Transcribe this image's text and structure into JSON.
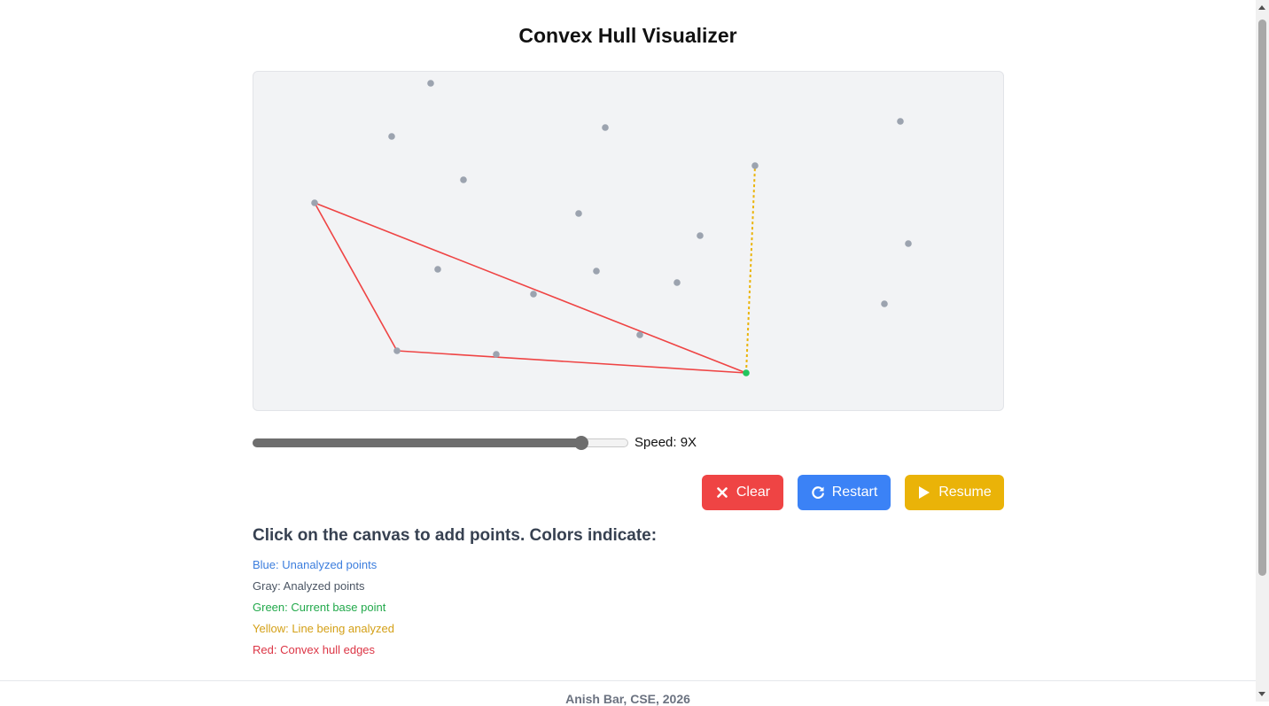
{
  "title": "Convex Hull Visualizer",
  "canvas": {
    "points": [
      [
        486,
        94
      ],
      [
        442,
        154
      ],
      [
        683,
        144
      ],
      [
        1016,
        137
      ],
      [
        852,
        187
      ],
      [
        523,
        203
      ],
      [
        355,
        229
      ],
      [
        653,
        241
      ],
      [
        790,
        266
      ],
      [
        1025,
        275
      ],
      [
        494,
        304
      ],
      [
        673,
        306
      ],
      [
        764,
        319
      ],
      [
        602,
        332
      ],
      [
        998,
        343
      ],
      [
        722,
        378
      ],
      [
        448,
        396
      ],
      [
        560,
        400
      ]
    ],
    "base_point": [
      842,
      421
    ],
    "hull_edges": [
      [
        [
          355,
          229
        ],
        [
          448,
          396
        ]
      ],
      [
        [
          448,
          396
        ],
        [
          842,
          421
        ]
      ],
      [
        [
          842,
          421
        ],
        [
          355,
          229
        ]
      ]
    ],
    "analyzing_line": [
      [
        842,
        421
      ],
      [
        852,
        187
      ]
    ],
    "colors": {
      "background": "#f2f3f5",
      "point": "#9ca3af",
      "base": "#22c55e",
      "hull": "#ef4444",
      "analyzing": "#eab308"
    }
  },
  "speed": {
    "label": "Speed: 9X",
    "value": 9,
    "fraction": 0.88
  },
  "buttons": {
    "clear": {
      "label": "Clear",
      "icon": "close-icon",
      "color": "#ef4444"
    },
    "restart": {
      "label": "Restart",
      "icon": "restart-icon",
      "color": "#3b82f6"
    },
    "resume": {
      "label": "Resume",
      "icon": "play-icon",
      "color": "#eab308"
    }
  },
  "legend": {
    "heading": "Click on the canvas to add points. Colors indicate:",
    "items": [
      {
        "text": "Blue: Unanalyzed points",
        "color": "#3b7ddd"
      },
      {
        "text": "Gray: Analyzed points",
        "color": "#4b5563"
      },
      {
        "text": "Green: Current base point",
        "color": "#22a94b"
      },
      {
        "text": "Yellow: Line being analyzed",
        "color": "#d4a017"
      },
      {
        "text": "Red: Convex hull edges",
        "color": "#dc3545"
      }
    ]
  },
  "footer": {
    "text": "Anish Bar, CSE, 2026"
  }
}
